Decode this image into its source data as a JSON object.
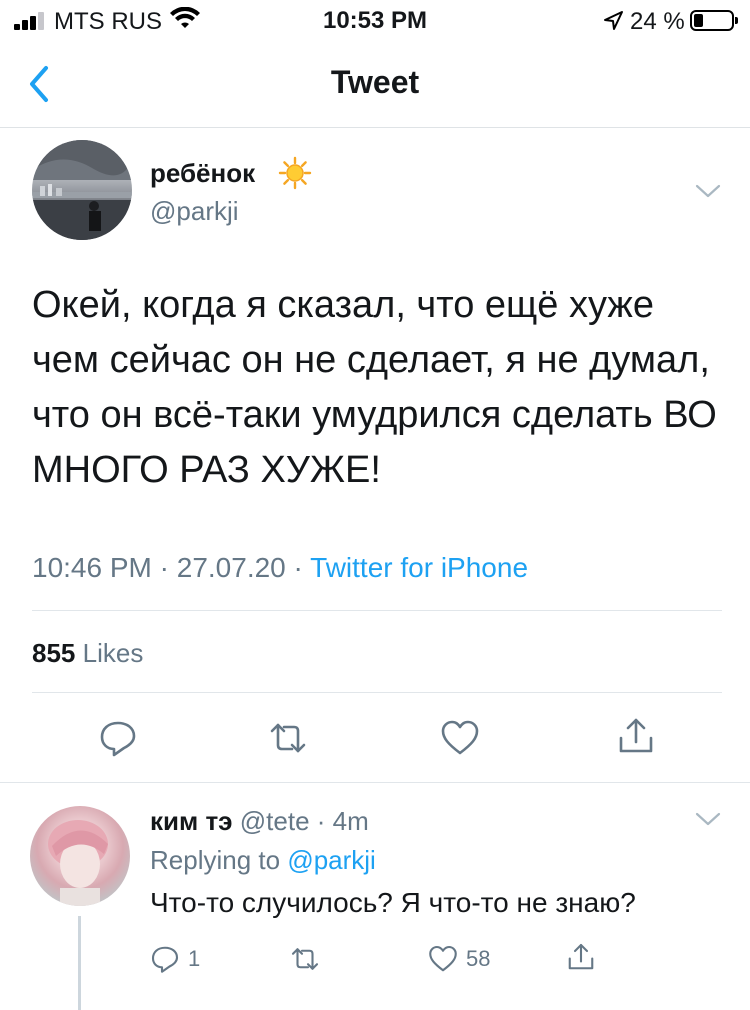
{
  "status_bar": {
    "carrier": "MTS RUS",
    "time": "10:53 PM",
    "battery_percent": "24 %",
    "battery_level": 0.24
  },
  "nav": {
    "title": "Tweet",
    "back_icon": "chevron-left-icon"
  },
  "tweet": {
    "display_name": "ребёнок",
    "name_emoji": "sun-emoji",
    "handle": "@parkji",
    "text": "Окей, когда я сказал, что ещё хуже чем сейчас он не сделает, я не думал, что он всё-таки умудрился сделать ВО МНОГО РАЗ ХУЖЕ!",
    "time": "10:46 PM",
    "date": "27.07.20",
    "source": "Twitter for iPhone",
    "likes_count": "855",
    "likes_label": "Likes"
  },
  "reply": {
    "display_name": "ким тэ",
    "handle": "@tete",
    "age": "4m",
    "replying_prefix": "Replying to",
    "replying_to": "@parkji",
    "text": "Что-то случилось? Я что-то не знаю?",
    "reply_count": "1",
    "like_count": "58"
  },
  "colors": {
    "accent": "#1da1f2",
    "secondary_text": "#657786",
    "divider": "#e1e6ea"
  }
}
